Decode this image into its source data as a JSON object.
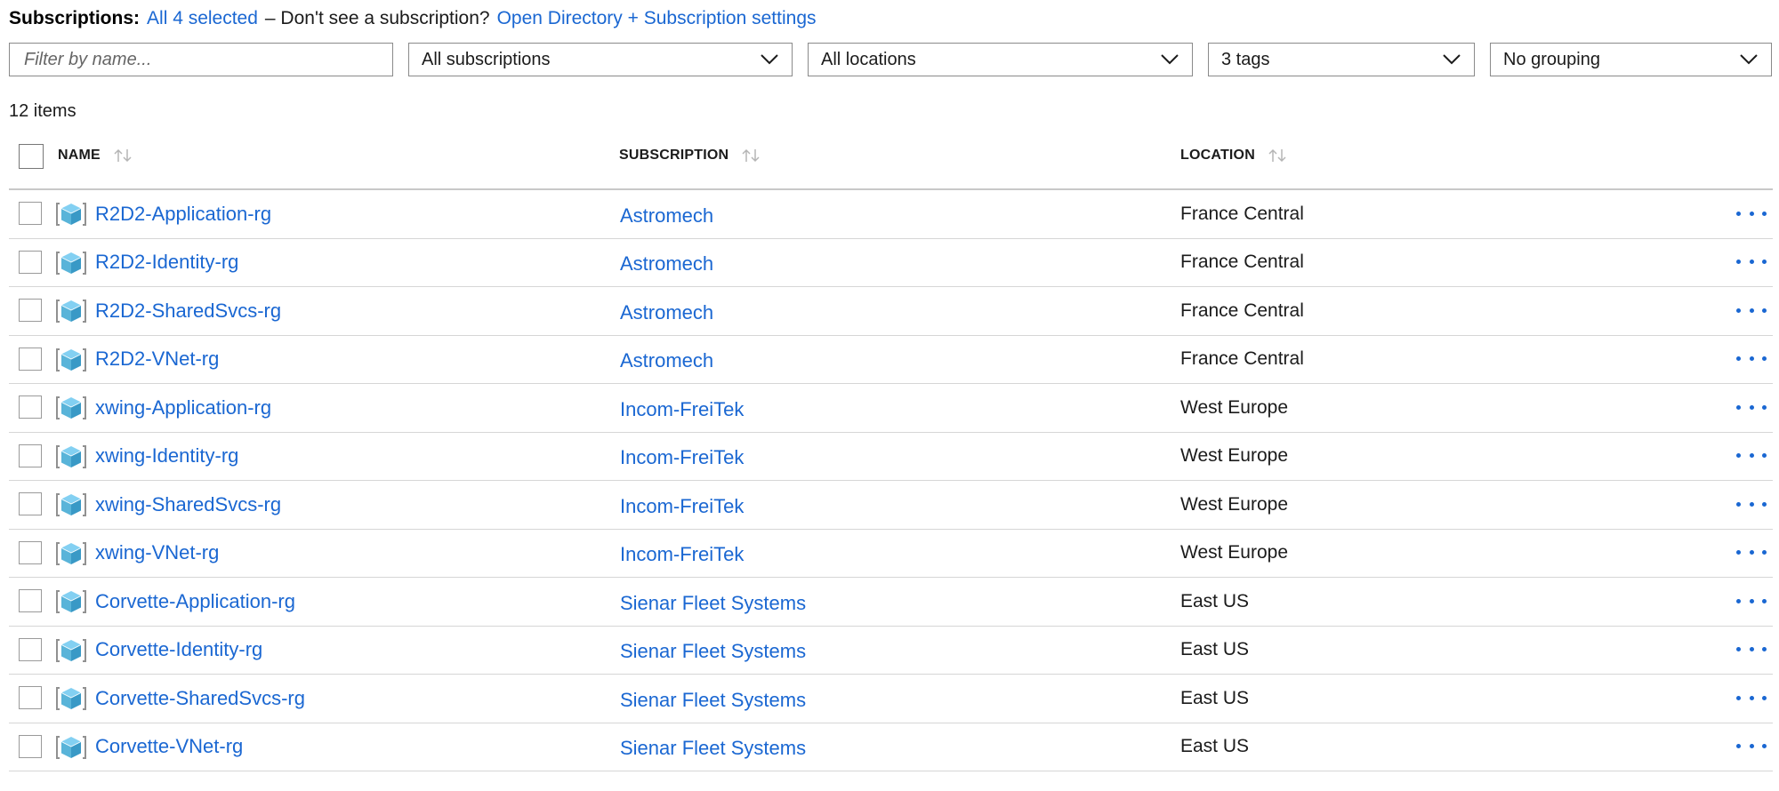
{
  "subscriptions_bar": {
    "label": "Subscriptions:",
    "selected_link": "All 4 selected",
    "prompt_text": "– Don't see a subscription?",
    "directory_link": "Open Directory + Subscription settings"
  },
  "filters": {
    "name_placeholder": "Filter by name...",
    "subscription_value": "All subscriptions",
    "location_value": "All locations",
    "tags_value": "3 tags",
    "grouping_value": "No grouping"
  },
  "items_count": "12 items",
  "table": {
    "columns": {
      "name": "NAME",
      "subscription": "SUBSCRIPTION",
      "location": "LOCATION"
    },
    "rows": [
      {
        "name": "R2D2-Application-rg",
        "subscription": "Astromech",
        "location": "France Central"
      },
      {
        "name": "R2D2-Identity-rg",
        "subscription": "Astromech",
        "location": "France Central"
      },
      {
        "name": "R2D2-SharedSvcs-rg",
        "subscription": "Astromech",
        "location": "France Central"
      },
      {
        "name": "R2D2-VNet-rg",
        "subscription": "Astromech",
        "location": "France Central"
      },
      {
        "name": "xwing-Application-rg",
        "subscription": "Incom-FreiTek",
        "location": "West Europe"
      },
      {
        "name": "xwing-Identity-rg",
        "subscription": "Incom-FreiTek",
        "location": "West Europe"
      },
      {
        "name": "xwing-SharedSvcs-rg",
        "subscription": "Incom-FreiTek",
        "location": "West Europe"
      },
      {
        "name": "xwing-VNet-rg",
        "subscription": "Incom-FreiTek",
        "location": "West Europe"
      },
      {
        "name": "Corvette-Application-rg",
        "subscription": "Sienar Fleet Systems",
        "location": "East US"
      },
      {
        "name": "Corvette-Identity-rg",
        "subscription": "Sienar Fleet Systems",
        "location": "East US"
      },
      {
        "name": "Corvette-SharedSvcs-rg",
        "subscription": "Sienar Fleet Systems",
        "location": "East US"
      },
      {
        "name": "Corvette-VNet-rg",
        "subscription": "Sienar Fleet Systems",
        "location": "East US"
      }
    ]
  },
  "icons": {
    "row_icon": "resource-group-icon",
    "row_menu": "more-icon",
    "dropdown": "chevron-down-icon",
    "sort": "sort-icon"
  },
  "colors": {
    "link": "#1a67d2",
    "text": "#1b1b1b",
    "border": "#8a8a8a",
    "row_divider": "#d6d6d6",
    "icon_blue": "#59b4d9"
  }
}
